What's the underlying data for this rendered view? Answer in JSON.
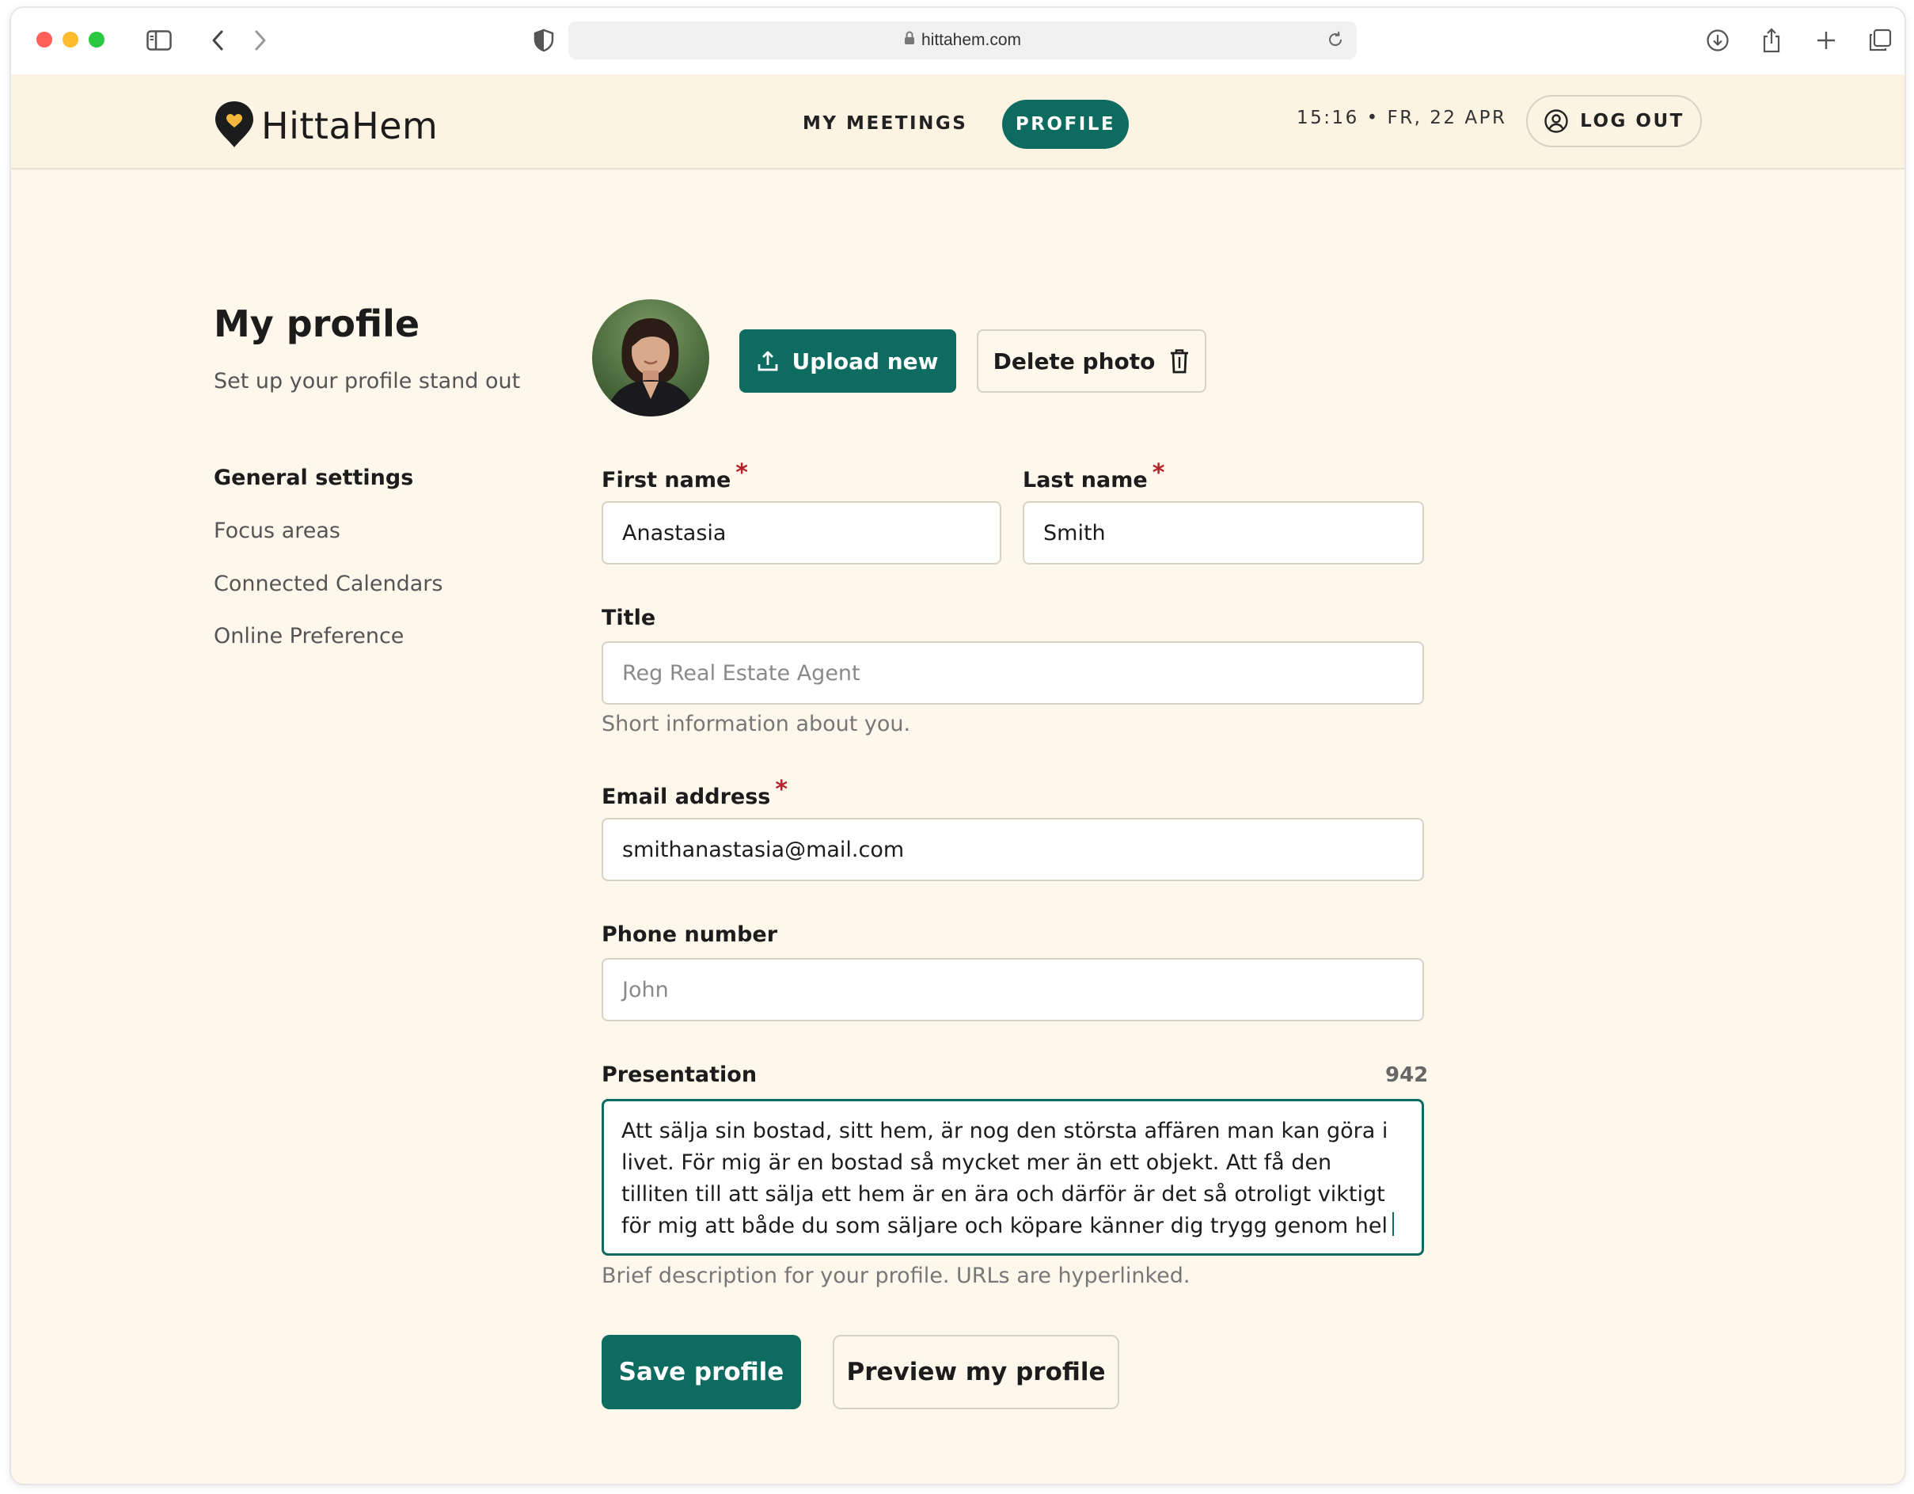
{
  "browser": {
    "url": "hittahem.com"
  },
  "header": {
    "brand": "HittaHem",
    "nav": {
      "meetings": "MY MEETINGS",
      "profile": "PROFILE"
    },
    "datetime": "15:16 • FR, 22 APR",
    "logout_label": "LOG OUT"
  },
  "sidebar": {
    "title": "My profile",
    "subtitle": "Set up your profile stand out",
    "items": [
      {
        "label": "General settings",
        "active": true
      },
      {
        "label": "Focus areas",
        "active": false
      },
      {
        "label": "Connected Calendars",
        "active": false
      },
      {
        "label": "Online Preference",
        "active": false
      }
    ]
  },
  "photo": {
    "upload_label": "Upload new",
    "delete_label": "Delete photo"
  },
  "form": {
    "first_name": {
      "label": "First name",
      "value": "Anastasia",
      "required_mark": "*"
    },
    "last_name": {
      "label": "Last name",
      "value": "Smith",
      "required_mark": "*"
    },
    "title": {
      "label": "Title",
      "placeholder": "Reg Real Estate Agent",
      "helper": "Short information about you."
    },
    "email": {
      "label": "Email address",
      "value": "smithanastasia@mail.com",
      "required_mark": "*"
    },
    "phone": {
      "label": "Phone number",
      "placeholder": "John"
    },
    "presentation": {
      "label": "Presentation",
      "counter": "942",
      "value": "Att sälja sin bostad, sitt hem, är nog den största affären man kan göra i livet. För mig är en bostad så mycket mer än ett objekt. Att få den tilliten till att sälja ett hem är en ära och därför är det så otroligt viktigt för mig att både du som säljare och köpare känner dig trygg genom hel",
      "helper": "Brief description for your profile. URLs are hyperlinked."
    }
  },
  "actions": {
    "save_label": "Save profile",
    "preview_label": "Preview my profile"
  },
  "colors": {
    "accent": "#0d6b5f",
    "page_bg": "#fdf7ec",
    "header_bg": "#fdf3e2",
    "required": "#b4222a"
  }
}
